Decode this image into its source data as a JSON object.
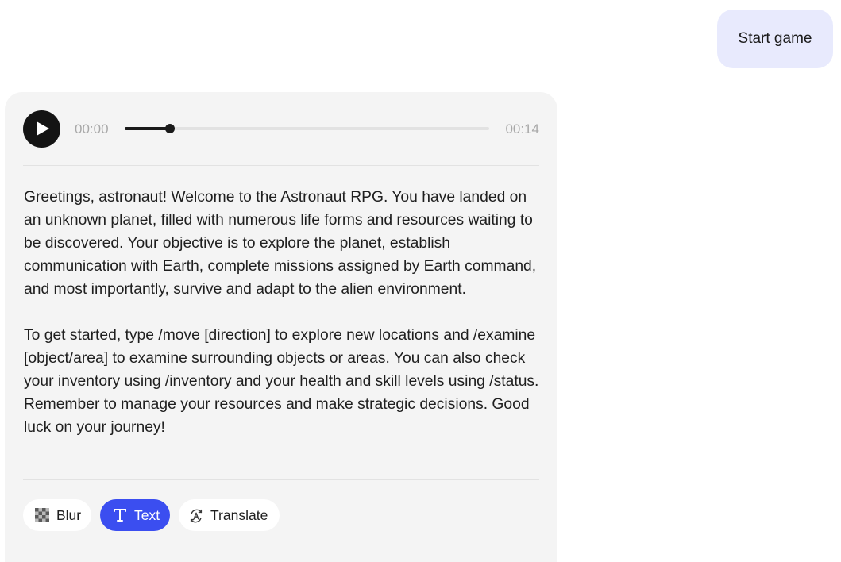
{
  "user_message": {
    "text": "Start game"
  },
  "assistant_message": {
    "audio": {
      "current_time": "00:00",
      "total_time": "00:14",
      "progress": 0.125
    },
    "paragraphs": [
      "Greetings, astronaut! Welcome to the Astronaut RPG. You have landed on an unknown planet, filled with numerous life forms and resources waiting to be discovered. Your objective is to explore the planet, establish communication with Earth, complete missions assigned by Earth command, and most importantly, survive and adapt to the alien environment.",
      "To get started, type /move [direction] to explore new locations and /examine [object/area] to examine surrounding objects or areas. You can also check your inventory using /inventory and your health and skill levels using /status. Remember to manage your resources and make strategic decisions. Good luck on your journey!"
    ],
    "actions": {
      "blur": {
        "label": "Blur",
        "icon": "checker-icon"
      },
      "text": {
        "label": "Text",
        "icon": "text-t-icon",
        "active": true
      },
      "translate": {
        "label": "Translate",
        "icon": "translate-icon"
      }
    }
  },
  "colors": {
    "user_bubble": "#e8eafd",
    "card": "#f4f4f4",
    "accent": "#3b4ef0"
  }
}
